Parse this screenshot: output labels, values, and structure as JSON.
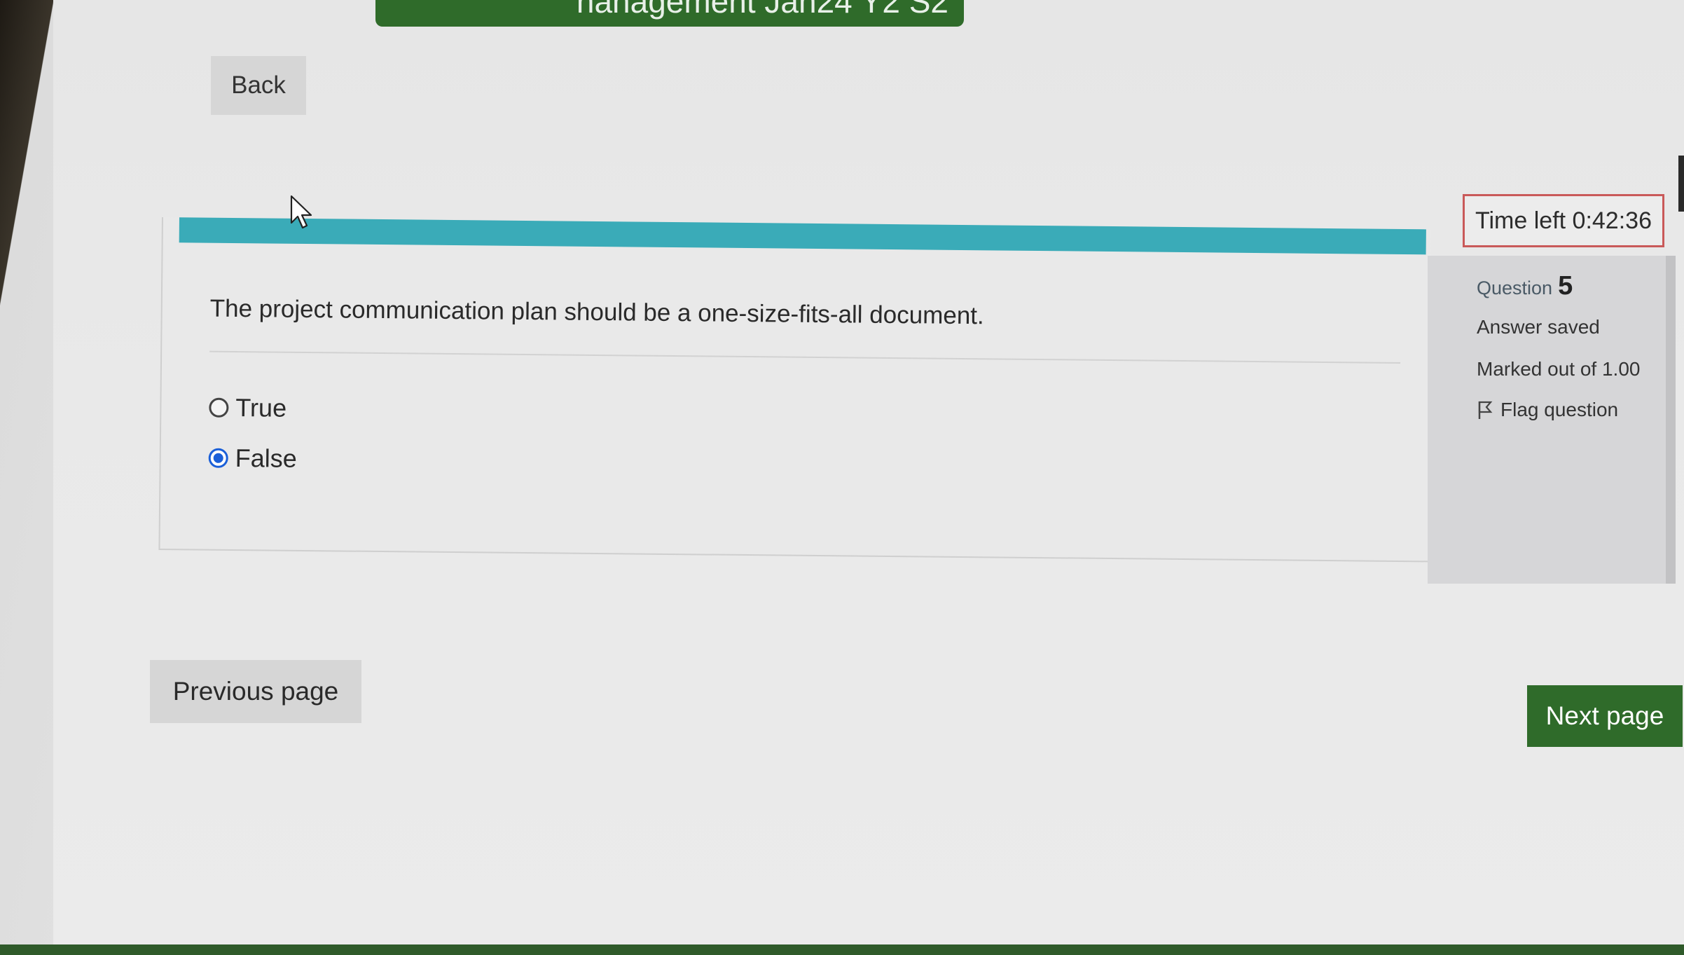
{
  "course_title": "nanagement Jan24 Y2 S2",
  "back_button": {
    "label": "Back"
  },
  "timer": {
    "label": "Time left 0:42:36"
  },
  "question": {
    "text": "The project communication plan should be a one-size-fits-all document.",
    "options": [
      {
        "label": "True",
        "selected": false
      },
      {
        "label": "False",
        "selected": true
      }
    ]
  },
  "info": {
    "question_label": "Question",
    "question_number": "5",
    "status": "Answer saved",
    "marks": "Marked out of 1.00",
    "flag_label": "Flag question"
  },
  "navigation": {
    "previous_label": "Previous page",
    "next_label": "Next page"
  },
  "colors": {
    "accent_bar": "#3aabb8",
    "primary_button": "#2f6b2a",
    "timer_border": "#c95959",
    "radio_selected": "#1a5fd8"
  }
}
